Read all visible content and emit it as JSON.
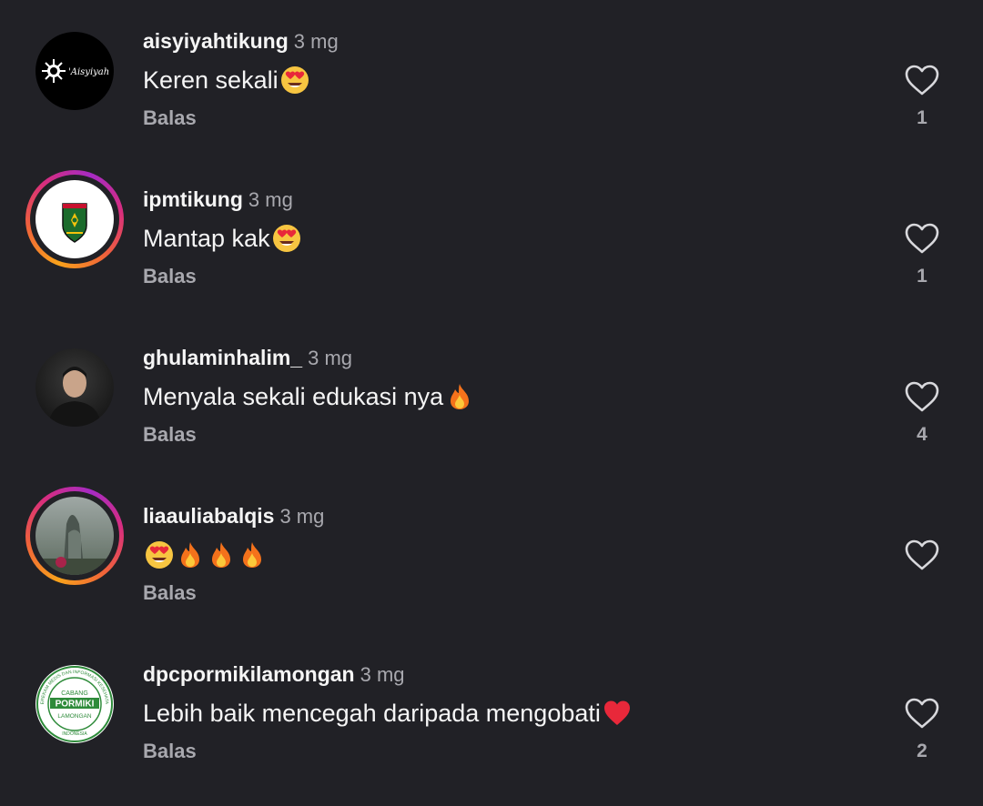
{
  "comments": [
    {
      "username": "aisyiyahtikung",
      "time": "3 mg",
      "text": "Keren sekali",
      "emojis": [
        "heart-eyes-emoji"
      ],
      "reply_label": "Balas",
      "likes": "1",
      "avatar": {
        "type": "logo",
        "logo_text": "'Aisyiyah",
        "story_ring": false
      }
    },
    {
      "username": "ipmtikung",
      "time": "3 mg",
      "text": "Mantap kak",
      "emojis": [
        "heart-eyes-emoji"
      ],
      "reply_label": "Balas",
      "likes": "1",
      "avatar": {
        "type": "shield-logo",
        "story_ring": true
      }
    },
    {
      "username": "ghulaminhalim_",
      "time": "3 mg",
      "text": "Menyala sekali edukasi nya",
      "emojis": [
        "fire-emoji"
      ],
      "reply_label": "Balas",
      "likes": "4",
      "avatar": {
        "type": "photo",
        "story_ring": false
      }
    },
    {
      "username": "liaauliabalqis",
      "time": "3 mg",
      "text": "",
      "emojis": [
        "heart-eyes-emoji",
        "fire-emoji",
        "fire-emoji",
        "fire-emoji"
      ],
      "reply_label": "Balas",
      "likes": "",
      "avatar": {
        "type": "photo",
        "story_ring": true
      }
    },
    {
      "username": "dpcpormikilamongan",
      "time": "3 mg",
      "text": "Lebih baik mencegah daripada mengobati",
      "emojis": [
        "red-heart-emoji"
      ],
      "reply_label": "Balas",
      "likes": "2",
      "avatar": {
        "type": "seal",
        "seal_main": "PORMIKI",
        "seal_top": "CABANG",
        "seal_bottom": "LAMONGAN",
        "seal_ring_text": "PEREKAM MEDIS DAN INFORMASI KESEHATAN",
        "seal_country": "INDONESIA",
        "story_ring": false
      }
    }
  ],
  "colors": {
    "background": "#212126",
    "text_primary": "#f5f5f5",
    "text_secondary": "#a8a8ae",
    "seal_green": "#2e8b3a"
  }
}
